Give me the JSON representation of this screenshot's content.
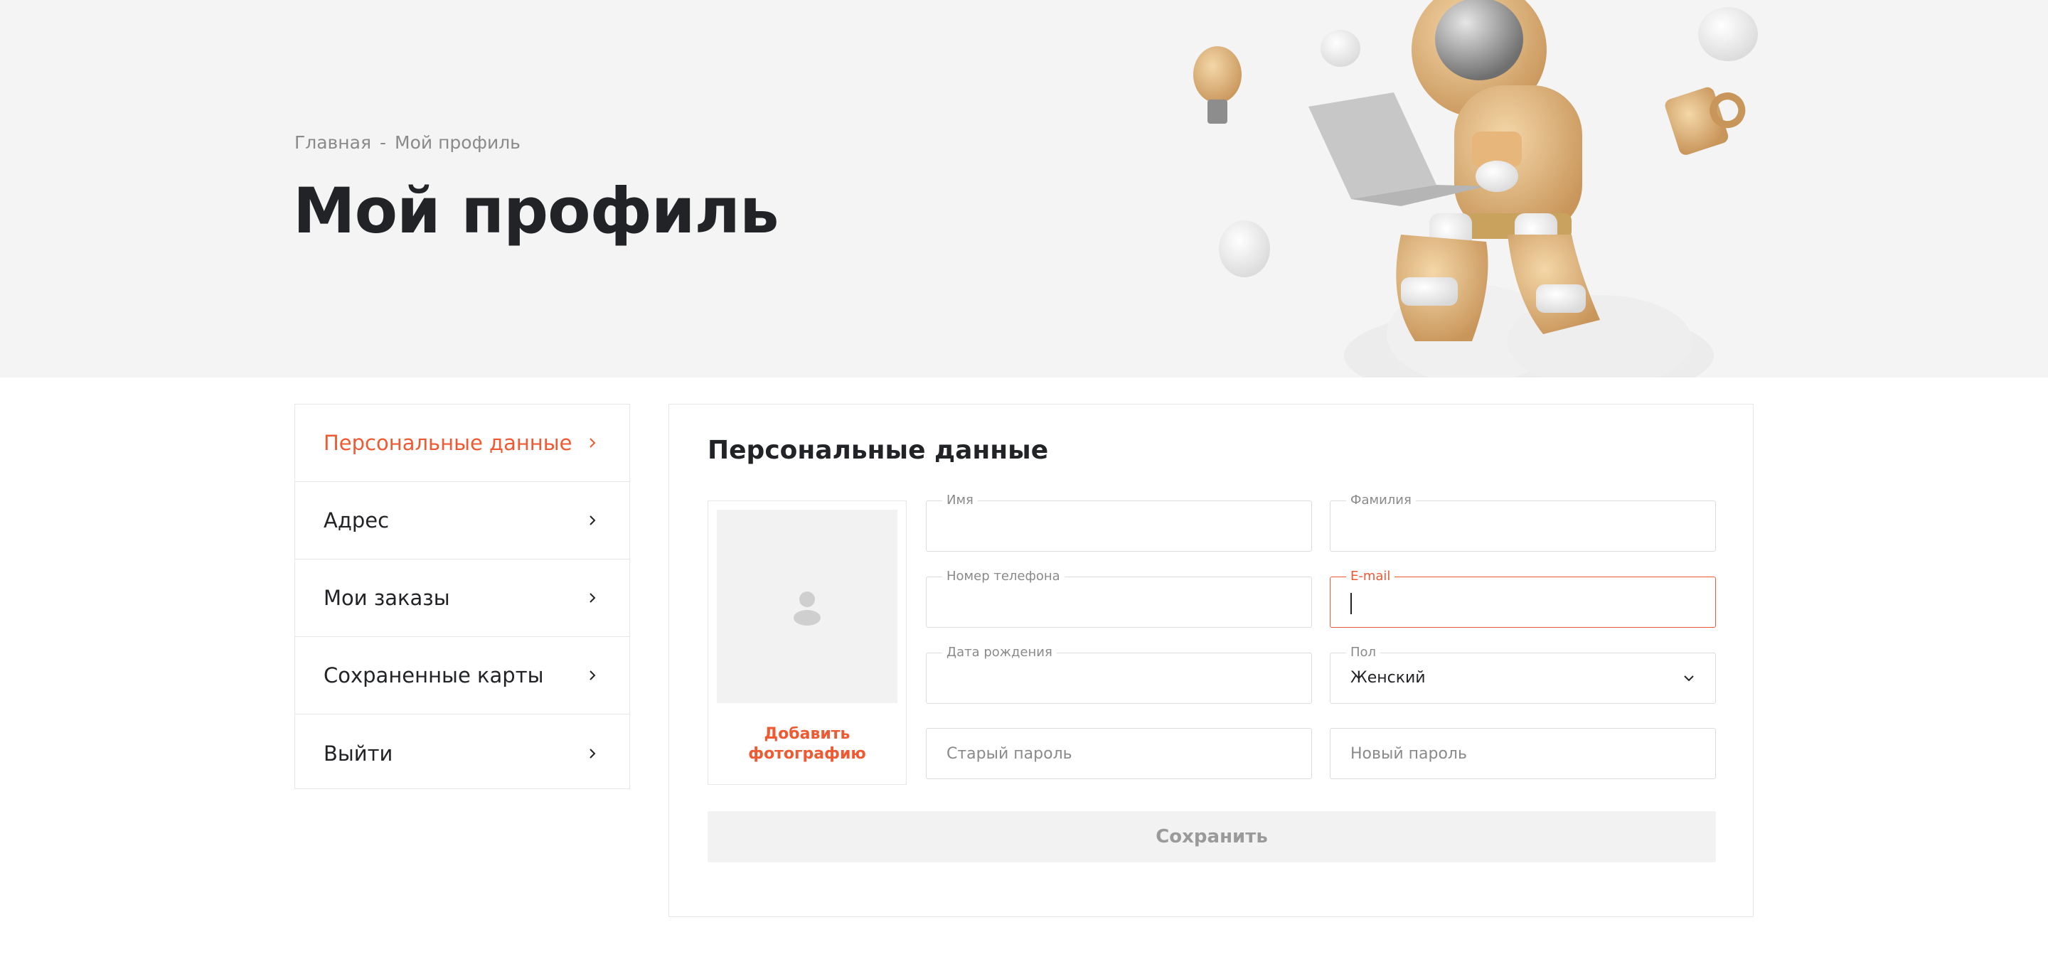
{
  "breadcrumb": {
    "home": "Главная",
    "separator": "-",
    "current": "Мой профиль"
  },
  "page_title": "Мой профиль",
  "sidebar": {
    "items": [
      {
        "label": "Персональные данные",
        "active": true
      },
      {
        "label": "Адрес"
      },
      {
        "label": "Мои заказы"
      },
      {
        "label": "Сохраненные карты"
      },
      {
        "label": "Выйти"
      }
    ]
  },
  "form": {
    "title": "Персональные данные",
    "add_photo": "Добавить фотографию",
    "first_name": {
      "label": "Имя",
      "value": ""
    },
    "last_name": {
      "label": "Фамилия",
      "value": ""
    },
    "phone": {
      "label": "Номер телефона",
      "value": ""
    },
    "email": {
      "label": "E-mail",
      "value": ""
    },
    "birth_date": {
      "label": "Дата рождения",
      "value": ""
    },
    "gender": {
      "label": "Пол",
      "value": "Женский"
    },
    "old_password": {
      "placeholder": "Старый пароль"
    },
    "new_password": {
      "placeholder": "Новый пароль"
    },
    "save_label": "Сохранить"
  },
  "colors": {
    "accent": "#f05a33",
    "text": "#222326",
    "muted": "#8a8a8a",
    "hero_bg": "#f4f4f4"
  }
}
